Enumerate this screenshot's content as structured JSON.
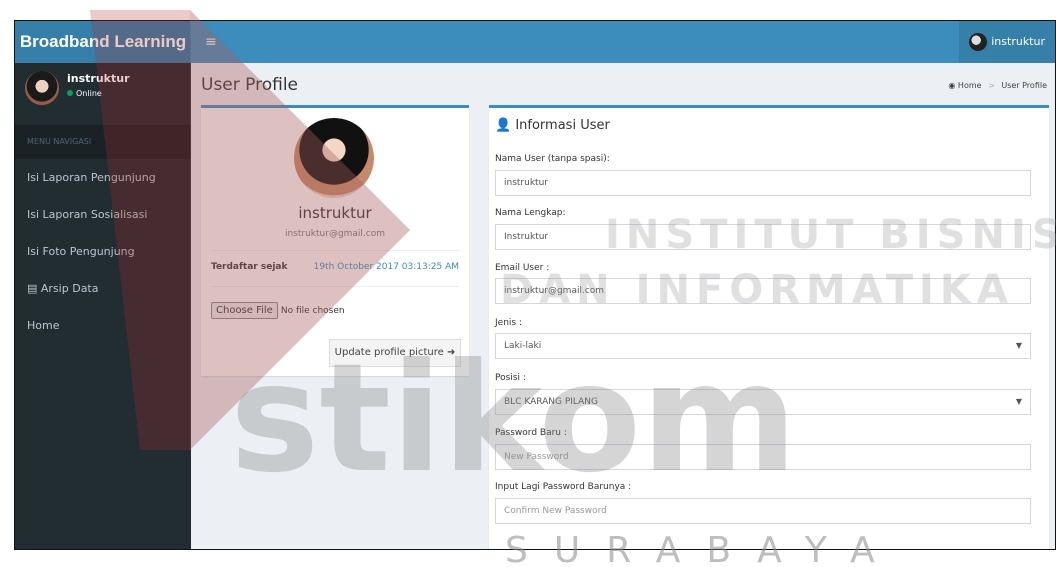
{
  "brand": "Broadband Learning",
  "topbar": {
    "menu_icon": "≡",
    "username": "instruktur"
  },
  "sidebar": {
    "username": "instruktur",
    "status": "Online",
    "header": "MENU NAVIGASI",
    "items": [
      {
        "label": "Isi Laporan Pengunjung"
      },
      {
        "label": "Isi Laporan Sosialisasi"
      },
      {
        "label": "Isi Foto Pengunjung"
      },
      {
        "label": "Arsip Data",
        "icon": "archive-icon"
      },
      {
        "label": "Home"
      }
    ]
  },
  "page": {
    "title": "User Profile",
    "breadcrumb": {
      "home": "Home",
      "current": "User Profile"
    }
  },
  "profile": {
    "name": "instruktur",
    "email": "instruktur@gmail.com",
    "since_label": "Terdaftar sejak",
    "since_value": "19th October 2017 03:13:25 AM",
    "choose_file": "Choose File",
    "no_file": "No file chosen",
    "update_button": "Update profile picture"
  },
  "info": {
    "title": "Informasi User",
    "fields": [
      {
        "label": "Nama User (tanpa spasi):",
        "value": "instruktur"
      },
      {
        "label": "Nama Lengkap:",
        "value": "Instruktur"
      },
      {
        "label": "Email User :",
        "value": "instruktur@gmail.com"
      },
      {
        "label": "Jenis :",
        "value": "Laki-laki"
      },
      {
        "label": "Posisi :",
        "value": "BLC KARANG PILANG"
      },
      {
        "label": "Password Baru :",
        "placeholder": "New Password"
      },
      {
        "label": "Input Lagi Password Barunya :",
        "placeholder": "Confirm New Password"
      }
    ]
  },
  "watermark": {
    "line1": "INSTITUT BISNIS",
    "line2": "DAN INFORMATIKA",
    "logo": "stikom",
    "city": "SURABAYA"
  },
  "colors": {
    "header": "#3c8dbc",
    "sidebar": "#222d32",
    "watermark_red": "#b22a2a"
  }
}
